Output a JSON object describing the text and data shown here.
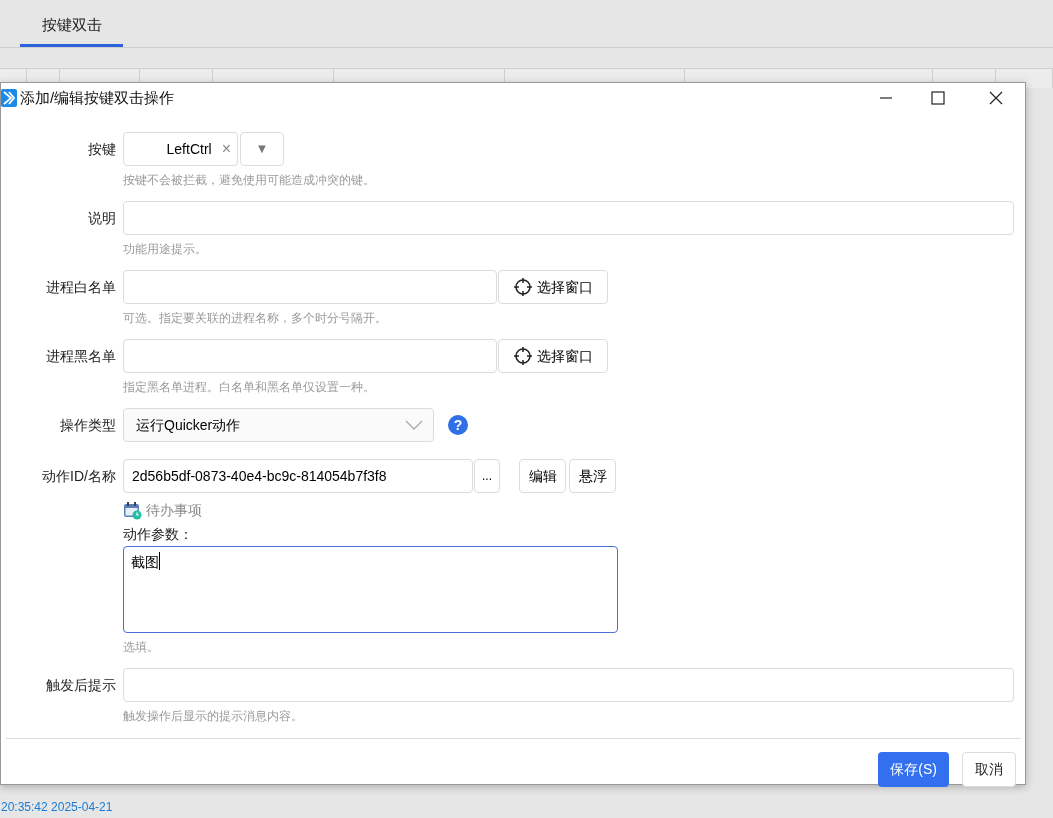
{
  "tabs": [
    {
      "label": "按键双击",
      "selected": true
    }
  ],
  "dialog": {
    "title": "添加/编辑按键双击操作",
    "fields": [
      {
        "kind": "key",
        "label": "按键",
        "value": "LeftCtrl",
        "clear": "×",
        "dropdown": "▼",
        "hint": "按键不会被拦截，避免使用可能造成冲突的键。"
      },
      {
        "kind": "text",
        "label": "说明",
        "hint": "功能用途提示。"
      },
      {
        "kind": "picker",
        "label": "进程白名单",
        "button": "选择窗口",
        "hint": "可选。指定要关联的进程名称，多个时分号隔开。"
      },
      {
        "kind": "picker",
        "label": "进程黑名单",
        "button": "选择窗口",
        "hint": "指定黑名单进程。白名单和黑名单仅设置一种。"
      },
      {
        "kind": "select",
        "label": "操作类型",
        "value": "运行Quicker动作",
        "help": "?"
      },
      {
        "kind": "action",
        "label": "动作ID/名称",
        "value": "2d56b5df-0873-40e4-bc9c-814054b7f3f8",
        "more": "...",
        "buttons": [
          "编辑",
          "悬浮"
        ],
        "link": "待办事项",
        "params_label": "动作参数：",
        "params_value": "截图",
        "hint": "选填。"
      },
      {
        "kind": "text",
        "label": "触发后提示",
        "hint": "触发操作后显示的提示消息内容。"
      }
    ],
    "buttons": [
      {
        "label": "保存(S)",
        "kind": "primary"
      },
      {
        "label": "取消",
        "kind": "default"
      }
    ]
  },
  "status_bar": {
    "time": "20:35:42 2025-04-21"
  }
}
